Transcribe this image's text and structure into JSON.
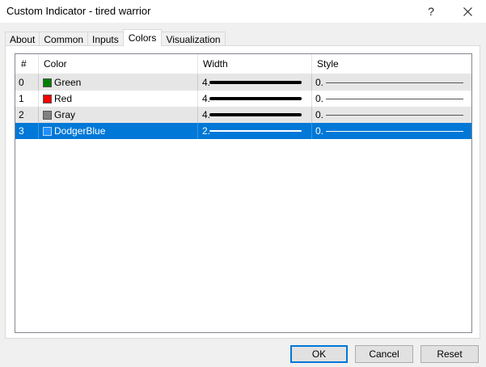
{
  "window": {
    "title": "Custom Indicator - tired warrior",
    "help_label": "?"
  },
  "tabs": [
    {
      "label": "About"
    },
    {
      "label": "Common"
    },
    {
      "label": "Inputs"
    },
    {
      "label": "Colors",
      "active": true
    },
    {
      "label": "Visualization"
    }
  ],
  "table": {
    "headers": {
      "num": "#",
      "color": "Color",
      "width": "Width",
      "style": "Style"
    },
    "rows": [
      {
        "num": "0",
        "color_name": "Green",
        "swatch": "#008000",
        "width_label": "4.",
        "line_width": 4,
        "style_label": "0."
      },
      {
        "num": "1",
        "color_name": "Red",
        "swatch": "#ff0000",
        "width_label": "4.",
        "line_width": 4,
        "style_label": "0."
      },
      {
        "num": "2",
        "color_name": "Gray",
        "swatch": "#808080",
        "width_label": "4.",
        "line_width": 4,
        "style_label": "0."
      },
      {
        "num": "3",
        "color_name": "DodgerBlue",
        "swatch": "#1e90ff",
        "width_label": "2.",
        "line_width": 2,
        "style_label": "0.",
        "selected": true
      }
    ]
  },
  "buttons": {
    "ok": "OK",
    "cancel": "Cancel",
    "reset": "Reset"
  },
  "colors": {
    "selection": "#0078d7",
    "alt_row": "#e6e6e6",
    "window_bg": "#f0f0f0"
  }
}
